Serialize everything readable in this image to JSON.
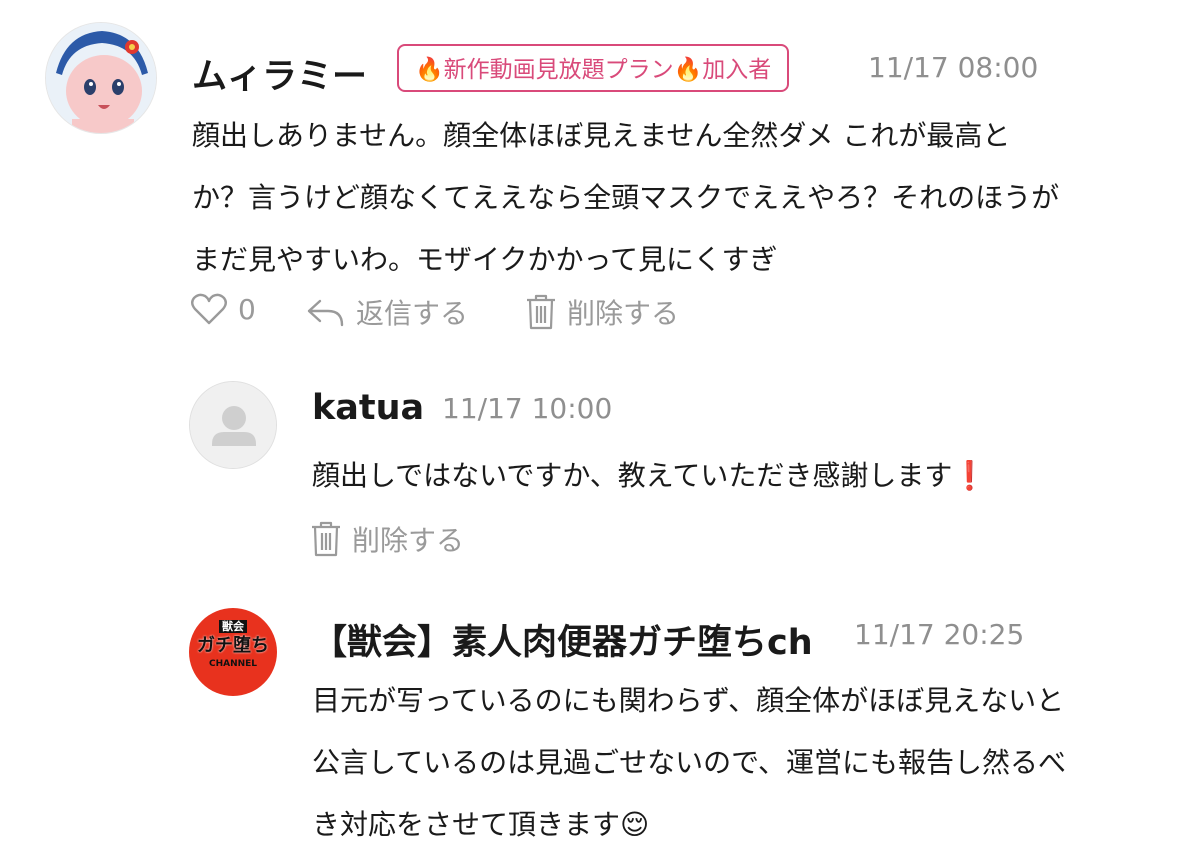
{
  "comments": [
    {
      "author": "ムィラミー",
      "badge": {
        "flame_left": "🔥",
        "text": "新作動画見放題プラン",
        "flame_right": "🔥",
        "suffix": "加入者"
      },
      "time": "11/17 08:00",
      "lines": [
        "顔出しありません。顔全体ほぼ見えません全然ダメ これが最高と",
        "か？言うけど顔なくてええなら全頭マスクでええやろ？それのほうが",
        "まだ見やすいわ。モザイクかかって見にくすぎ"
      ],
      "likes": "0",
      "reply_label": "返信する",
      "delete_label": "削除する",
      "avatar_icon": "anime-character-avatar"
    },
    {
      "author": "katua",
      "time": "11/17 10:00",
      "text": "顔出しではないですか、教えていただき感謝します",
      "emoji": "❗",
      "delete_label": "削除する",
      "avatar_icon": "default-user-avatar"
    },
    {
      "author": "【獣会】素人肉便器ガチ堕ちch",
      "time": "11/17 20:25",
      "lines": [
        "目元が写っているのにも関わらず、顔全体がほぼ見えないと",
        "公言しているのは見過ごせないので、運営にも報告し然るべ",
        "き対応をさせて頂きます"
      ],
      "emoji": "😌",
      "avatar": {
        "top": "獣会",
        "middle": "ガチ堕ち",
        "bottom": "CHANNEL",
        "bg": "#e8321e"
      }
    }
  ],
  "colors": {
    "badge": "#d94a7a",
    "muted": "#9a9a9a",
    "time": "#8f8f8f"
  }
}
